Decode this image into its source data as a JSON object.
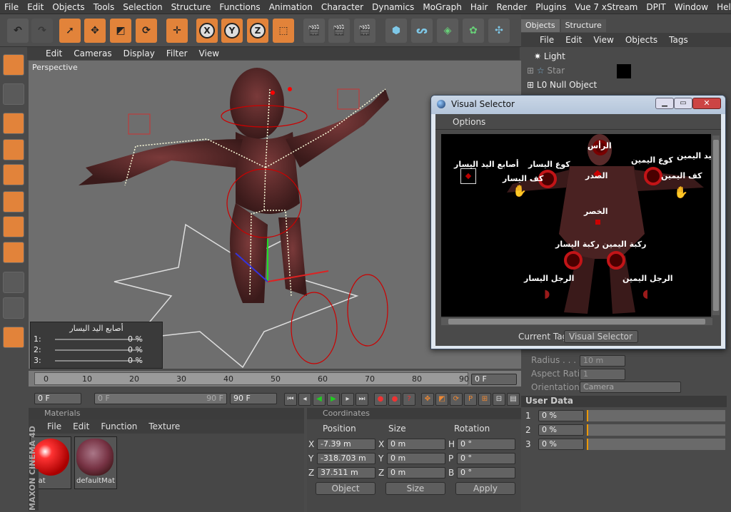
{
  "menu": [
    "File",
    "Edit",
    "Objects",
    "Tools",
    "Selection",
    "Structure",
    "Functions",
    "Animation",
    "Character",
    "Dynamics",
    "MoGraph",
    "Hair",
    "Render",
    "Plugins",
    "Vue 7 xStream",
    "DPIT",
    "Window",
    "Help"
  ],
  "viewport": {
    "menu": [
      "Edit",
      "Cameras",
      "Display",
      "Filter",
      "View"
    ],
    "label": "Perspective"
  },
  "morph": {
    "title": "أصابع اليد اليسار",
    "rows": [
      {
        "label": "1:",
        "value": "0 %"
      },
      {
        "label": "2:",
        "value": "0 %"
      },
      {
        "label": "3:",
        "value": "0 %"
      }
    ]
  },
  "timeline": {
    "ticks": [
      "0",
      "10",
      "20",
      "30",
      "40",
      "50",
      "60",
      "70",
      "80",
      "90"
    ],
    "current": "0 F",
    "start": "0 F",
    "left_field": "0 F",
    "end_field": "90 F",
    "max": "90 F"
  },
  "materials": {
    "title": "Materials",
    "menu": [
      "File",
      "Edit",
      "Function",
      "Texture"
    ],
    "items": [
      "Mat",
      "defaultMat"
    ]
  },
  "coordinates": {
    "title": "Coordinates",
    "headers": [
      "Position",
      "Size",
      "Rotation"
    ],
    "rows": [
      {
        "axis": "X",
        "pos": "-7.39 m",
        "sizelabel": "X",
        "size": "0 m",
        "rotlabel": "H",
        "rot": "0 °"
      },
      {
        "axis": "Y",
        "pos": "-318.703 m",
        "sizelabel": "Y",
        "size": "0 m",
        "rotlabel": "P",
        "rot": "0 °"
      },
      {
        "axis": "Z",
        "pos": "37.511 m",
        "sizelabel": "Z",
        "size": "0 m",
        "rotlabel": "B",
        "rot": "0 °"
      }
    ],
    "mode": "Object",
    "sizemode": "Size",
    "apply": "Apply"
  },
  "objects": {
    "tabs": [
      "Objects",
      "Structure"
    ],
    "menu": [
      "File",
      "Edit",
      "View",
      "Objects",
      "Tags"
    ],
    "items": [
      "Light",
      "Star",
      "Null Object"
    ]
  },
  "attributes": {
    "radius_label": "Radius . . . .",
    "radius": "10 m",
    "aspect_label": "Aspect Ratio",
    "aspect": "1",
    "orient_label": "Orientation",
    "orient": "Camera",
    "userdata": "User Data",
    "rows": [
      {
        "label": "1",
        "value": "0 %"
      },
      {
        "label": "2",
        "value": "0 %"
      },
      {
        "label": "3",
        "value": "0 %"
      }
    ]
  },
  "visual_selector": {
    "title": "Visual Selector",
    "menu": "Options",
    "current_tag_label": "Current Tag",
    "current_tag": "Visual Selector",
    "labels": {
      "head": "الرأس",
      "chest": "الصدر",
      "right_hand": "اليد اليمين",
      "left_fingers": "أصابع اليد اليسار",
      "left_elbow": "كوع اليسار",
      "left_palm": "كف اليسار",
      "right_elbow": "كوع اليمين",
      "right_palm": "كف اليمين",
      "pinky": "الخصر",
      "knees": "ركبة اليمين ركبة اليسار",
      "left_leg": "الرجل اليسار",
      "right_leg": "الرجل اليمين"
    }
  },
  "brand": "MAXON CINEMA 4D"
}
